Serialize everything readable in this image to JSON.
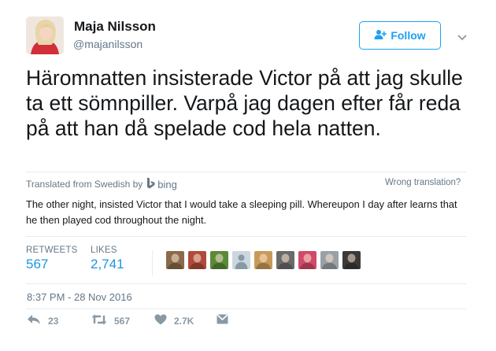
{
  "user": {
    "name": "Maja Nilsson",
    "handle": "@majanilsson"
  },
  "follow": {
    "label": "Follow"
  },
  "tweet": {
    "text": "Häromnatten insisterade Victor på att jag skulle ta ett sömnpiller. Varpå jag dagen efter får reda på att han då spelade cod hela natten."
  },
  "translation": {
    "prefix": "Translated from Swedish by",
    "service": "bing",
    "wrong_label": "Wrong translation?",
    "text": "The other night, insisted Victor that I would take a sleeping pill. Whereupon I day after learns that he then played cod throughout the night."
  },
  "stats": {
    "retweets_label": "RETWEETS",
    "retweets_value": "567",
    "likes_label": "LIKES",
    "likes_value": "2,741"
  },
  "likers": [
    {
      "color": "#8a6a4a",
      "icon": "avatar-1"
    },
    {
      "color": "#b04a3a",
      "icon": "avatar-2"
    },
    {
      "color": "#5a8a3a",
      "icon": "avatar-3"
    },
    {
      "color": "#ccd6dd",
      "icon": "default-egg-avatar"
    },
    {
      "color": "#c89a5a",
      "icon": "avatar-5"
    },
    {
      "color": "#6a6a6a",
      "icon": "avatar-6"
    },
    {
      "color": "#d04a6a",
      "icon": "avatar-7"
    },
    {
      "color": "#9aa0a6",
      "icon": "avatar-8"
    },
    {
      "color": "#3a3a3a",
      "icon": "avatar-9"
    }
  ],
  "timestamp": "8:37 PM - 28 Nov 2016",
  "actions": {
    "reply_count": "23",
    "retweet_count": "567",
    "like_count": "2.7K"
  },
  "colors": {
    "accent": "#1da1f2",
    "link": "#1b95e0",
    "muted": "#657786",
    "icon": "#8899a6"
  }
}
